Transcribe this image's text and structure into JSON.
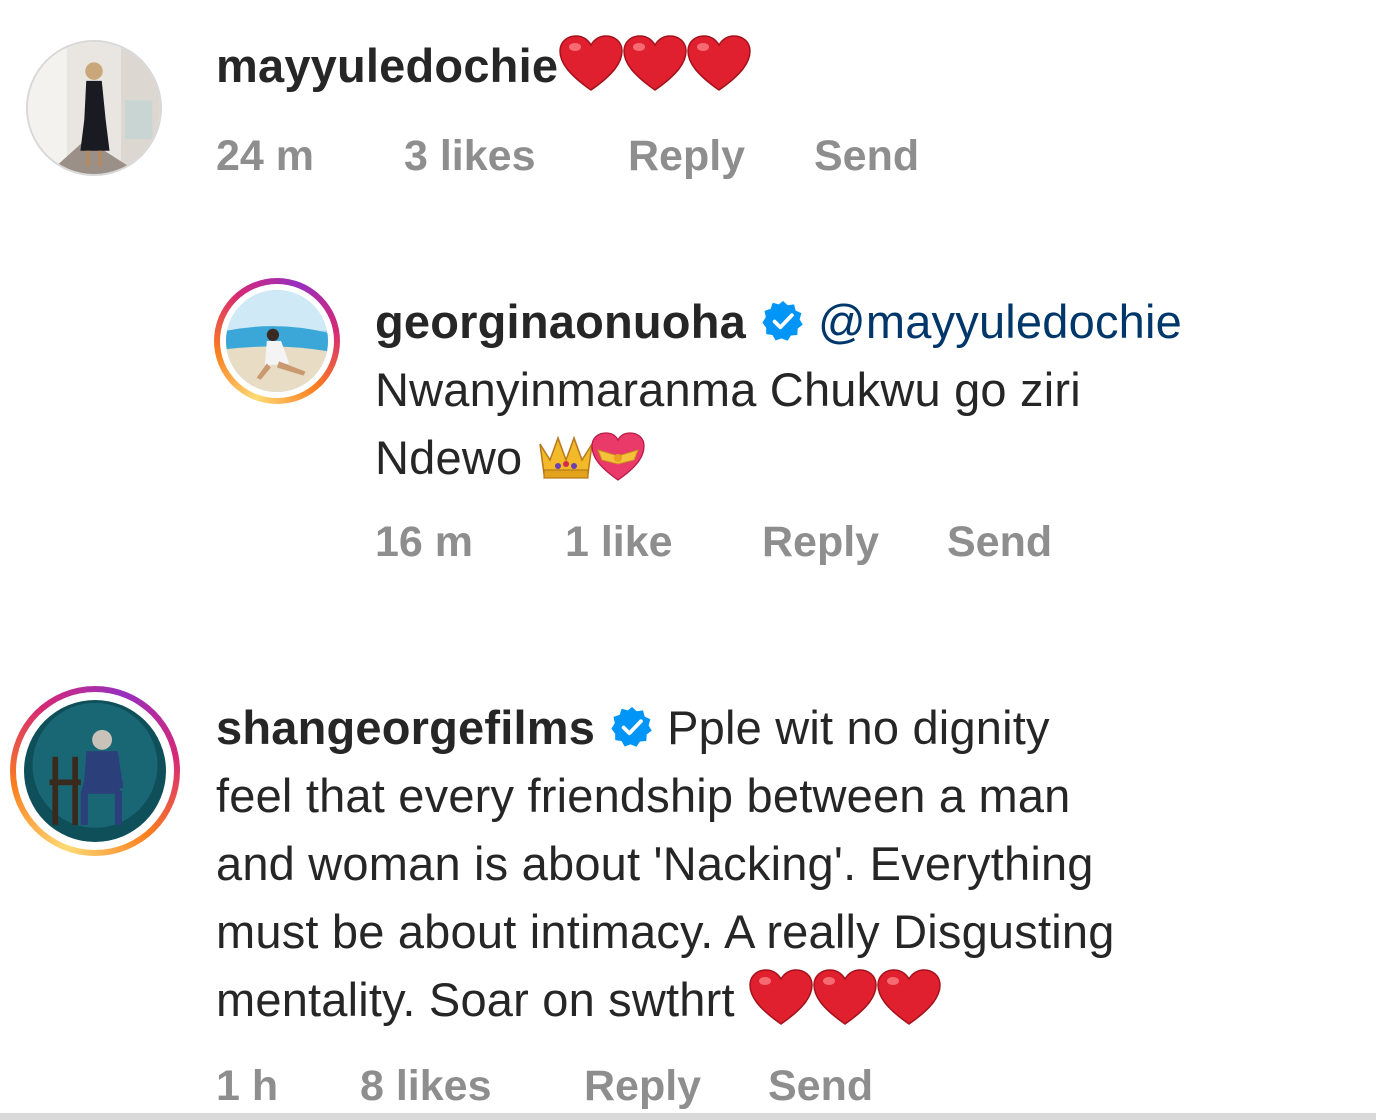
{
  "comments": [
    {
      "username": "mayyuledochie",
      "text": "",
      "emoji": [
        "red-heart",
        "red-heart",
        "red-heart"
      ],
      "time": "24 m",
      "likes": "3 likes",
      "reply_label": "Reply",
      "send_label": "Send"
    },
    {
      "username": "georginaonuoha",
      "verified": true,
      "mention": "@mayyuledochie",
      "text_line1": "Nwanyinmaranma Chukwu go ziri",
      "text_line2": "Ndewo",
      "emoji": [
        "crown",
        "heart-with-ribbon"
      ],
      "time": "16 m",
      "likes": "1 like",
      "reply_label": "Reply",
      "send_label": "Send"
    },
    {
      "username": "shangeorgefilms",
      "verified": true,
      "text_line1": "Pple wit no dignity",
      "text_line2": "feel that every friendship between a man",
      "text_line3": "and woman is about 'Nacking'. Everything",
      "text_line4": "must be about intimacy. A really Disgusting",
      "text_line5": "mentality. Soar on swthrt",
      "emoji": [
        "red-heart",
        "red-heart",
        "red-heart"
      ],
      "time": "1 h",
      "likes": "8 likes",
      "reply_label": "Reply",
      "send_label": "Send"
    }
  ],
  "colors": {
    "text": "#262626",
    "meta": "#8e8e8e",
    "mention": "#00376b",
    "verified": "#0095f6",
    "heart": "#e0202e"
  }
}
